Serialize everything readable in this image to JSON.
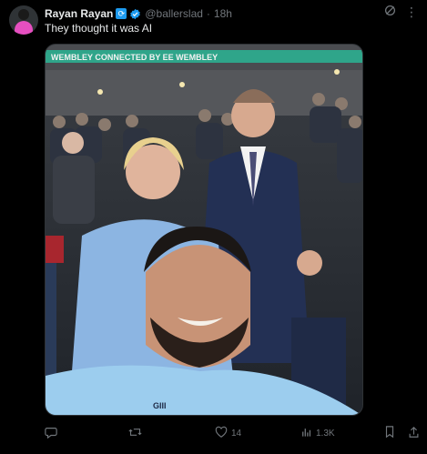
{
  "post": {
    "display_name": "Rayan Rayan",
    "name_badge_icon": "recycle-emoji-icon",
    "verified_icon": "verified-badge-icon",
    "handle": "@ballerslad",
    "separator": "·",
    "time": "18h",
    "text": "They thought it was AI",
    "banner_text": "WEMBLEY  CONNECTED BY EE  WEMBLEY",
    "top_icons": [
      "grok-icon",
      "more-icon"
    ]
  },
  "actions": {
    "reply": {
      "icon": "reply-icon",
      "count": ""
    },
    "repost": {
      "icon": "repost-icon",
      "count": ""
    },
    "like": {
      "icon": "heart-icon",
      "count": "14"
    },
    "views": {
      "icon": "views-icon",
      "count": "1.3K"
    },
    "bookmark": {
      "icon": "bookmark-icon"
    },
    "share": {
      "icon": "share-icon"
    }
  },
  "colors": {
    "background": "#000000",
    "text_primary": "#e7e9ea",
    "text_secondary": "#71767b",
    "verified": "#1d9bf0"
  }
}
